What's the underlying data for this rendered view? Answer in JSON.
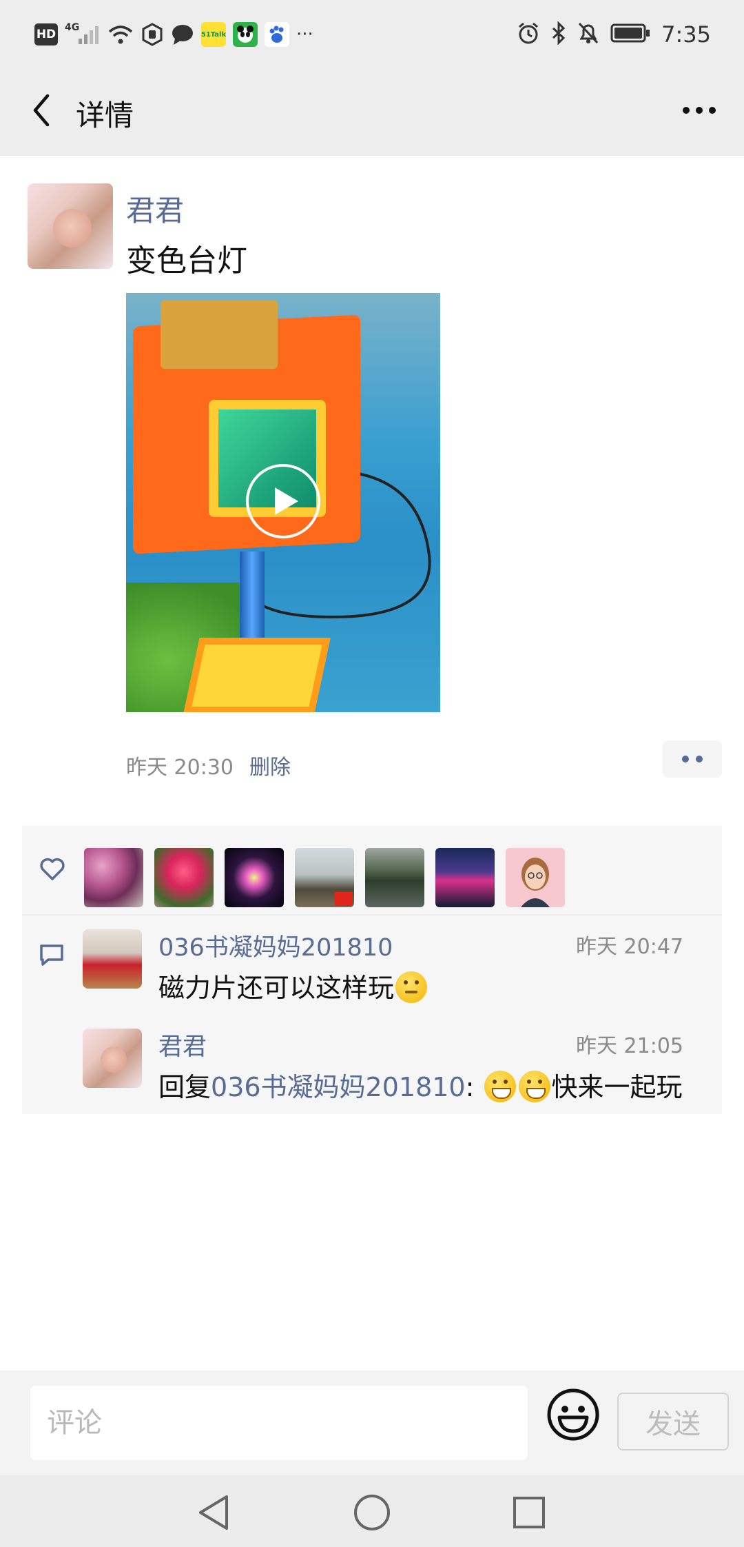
{
  "status_bar": {
    "hd_label": "HD",
    "network_label": "4G",
    "app_badge_1": "51Talk",
    "time": "7:35",
    "left_icons": [
      "hd-icon",
      "signal-4g-icon",
      "wifi-icon",
      "shield-icon",
      "chat-bubble-icon",
      "51talk-app-icon",
      "panda-app-icon",
      "baidu-paw-icon",
      "overflow-dots-icon"
    ],
    "right_icons": [
      "alarm-icon",
      "bluetooth-icon",
      "mute-bell-icon",
      "battery-icon"
    ]
  },
  "nav": {
    "title": "详情",
    "back_icon": "chevron-left-icon",
    "more_icon": "more-dots-icon"
  },
  "post": {
    "author": "君君",
    "text": "变色台灯",
    "media_type": "video",
    "time": "昨天 20:30",
    "delete_label": "删除"
  },
  "likes": {
    "icon": "heart-icon",
    "count": 7
  },
  "comments": {
    "icon": "comment-icon",
    "items": [
      {
        "author": "036书凝妈妈201810",
        "time": "昨天 20:47",
        "text": "磁力片还可以这样玩",
        "emoji": "thinking-emoji"
      },
      {
        "author": "君君",
        "time": "昨天 21:05",
        "reply_prefix": "回复",
        "reply_to": "036书凝妈妈201810",
        "reply_sep": ":",
        "emojis": [
          "grinning-emoji",
          "grinning-emoji"
        ],
        "text": "快来一起玩"
      }
    ]
  },
  "input_bar": {
    "placeholder": "评论",
    "send_label": "发送",
    "emoji_icon": "smiley-icon"
  },
  "colors": {
    "link_blue": "#576b95",
    "bar_gray": "#ededed",
    "panel_gray": "#f6f6f6"
  }
}
